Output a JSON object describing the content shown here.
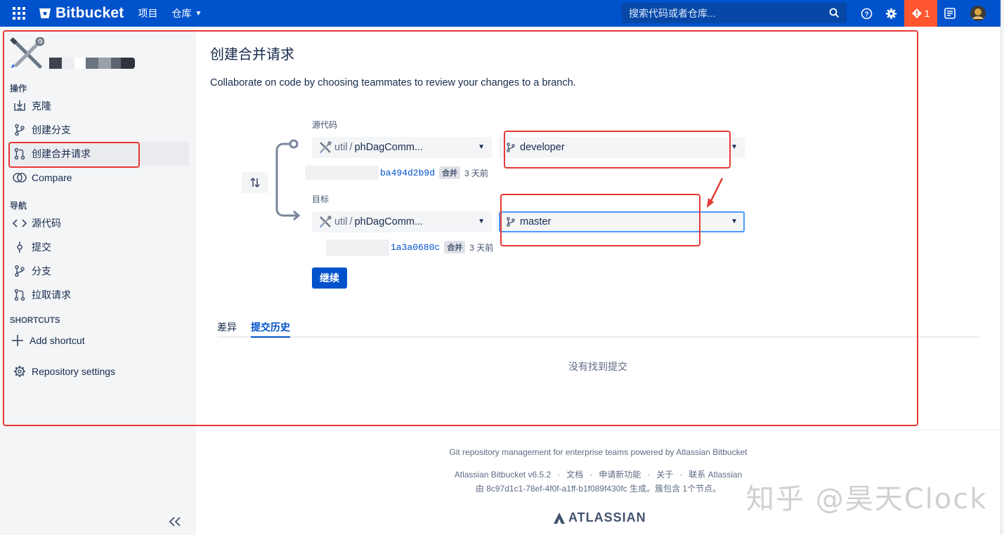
{
  "topbar": {
    "brand": "Bitbucket",
    "nav_projects": "项目",
    "nav_repos": "仓库",
    "search_placeholder": "搜索代码或者仓库...",
    "alert_count": "1"
  },
  "sidebar": {
    "section_actions": "操作",
    "actions": [
      {
        "label": "克隆",
        "icon": "clone-icon"
      },
      {
        "label": "创建分支",
        "icon": "branch-icon"
      },
      {
        "label": "创建合并请求",
        "icon": "pull-request-icon"
      },
      {
        "label": "Compare",
        "icon": "compare-icon"
      }
    ],
    "section_nav": "导航",
    "nav": [
      {
        "label": "源代码",
        "icon": "code-icon"
      },
      {
        "label": "提交",
        "icon": "commit-icon"
      },
      {
        "label": "分支",
        "icon": "branch-icon"
      },
      {
        "label": "拉取请求",
        "icon": "pull-request-icon"
      }
    ],
    "section_shortcuts": "SHORTCUTS",
    "add_shortcut": "Add shortcut",
    "repo_settings": "Repository settings"
  },
  "main": {
    "title": "创建合并请求",
    "description": "Collaborate on code by choosing teammates to review your changes to a branch.",
    "source": {
      "label": "源代码",
      "repo_prefix": "util",
      "repo_name": "phDagComm...",
      "branch": "developer",
      "hash": "ba494d2b9d",
      "merge_label": "合并",
      "time": "3 天前"
    },
    "target": {
      "label": "目标",
      "repo_prefix": "util",
      "repo_name": "phDagComm...",
      "branch": "master",
      "hash": "1a3a0680c",
      "merge_label": "合并",
      "time": "3 天前"
    },
    "continue_label": "继续",
    "tabs": [
      "差异",
      "提交历史"
    ],
    "empty_message": "没有找到提交"
  },
  "footer": {
    "line1": "Git repository management for enterprise teams powered by Atlassian Bitbucket",
    "version": "Atlassian Bitbucket v6.5.2",
    "docs": "文档",
    "feature_request": "申请新功能",
    "about": "关于",
    "contact": "联系 Atlassian",
    "line3": "由 8c97d1c1-78ef-4f0f-a1ff-b1f089f430fc 生成。簇包含 1个节点。",
    "atlassian": "ATLASSIAN"
  },
  "watermark": "知乎 @昊天Clock",
  "colors": {
    "brand": "#0052cc",
    "alert": "#ff5630",
    "annotation": "#e53935"
  }
}
